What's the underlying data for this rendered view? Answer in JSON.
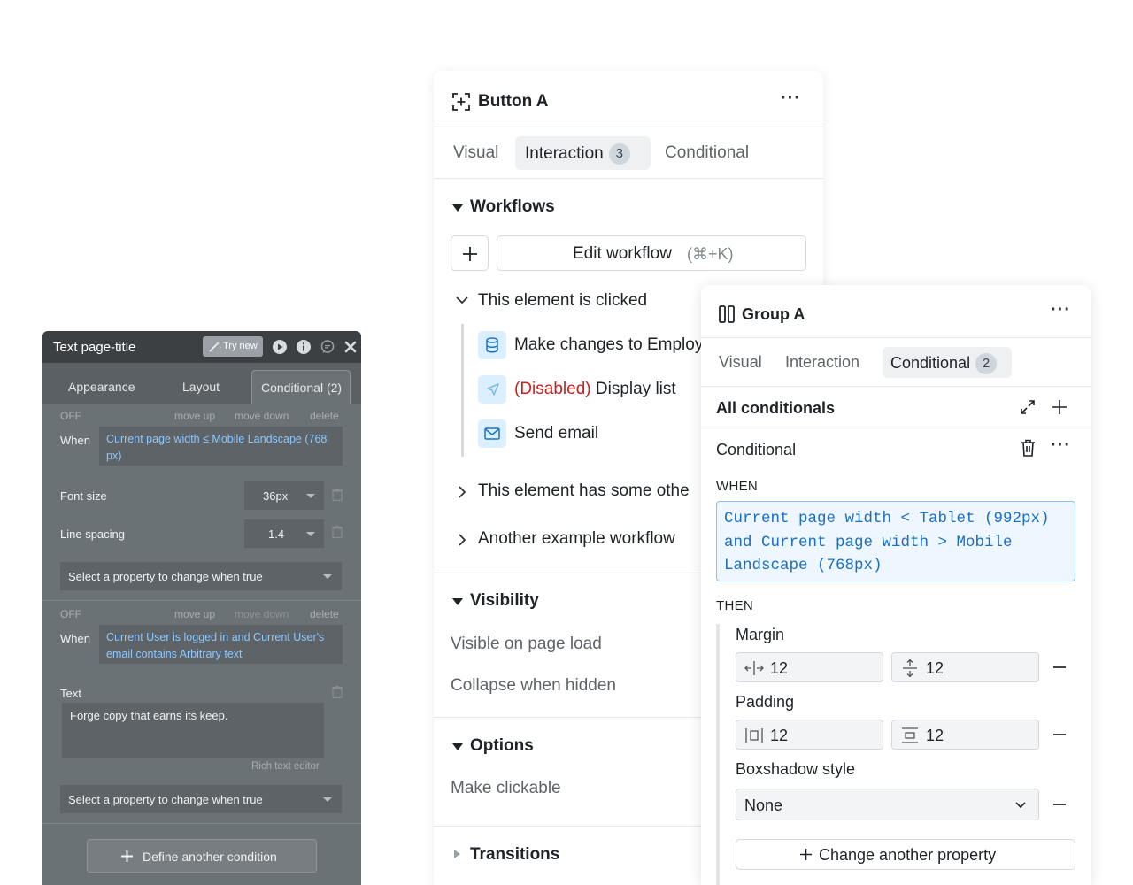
{
  "legacy_panel": {
    "title": "Text page-title",
    "try_new_label": "Try new",
    "tabs": [
      "Appearance",
      "Layout",
      "Conditional (2)"
    ],
    "conditions": [
      {
        "state": "OFF",
        "actions": [
          "move up",
          "move down",
          "delete"
        ],
        "when_label": "When",
        "expression": "Current page width ≤ Mobile Landscape (768 px)",
        "properties": [
          {
            "label": "Font size",
            "value": "36px"
          },
          {
            "label": "Line spacing",
            "value": "1.4"
          }
        ],
        "select_placeholder": "Select a property to change when true"
      },
      {
        "state": "OFF",
        "actions": [
          "move up",
          "move down",
          "delete"
        ],
        "when_label": "When",
        "expression": "Current User is logged in and Current User's email contains Arbitrary text",
        "text_label": "Text",
        "text_value": "Forge copy that earns its keep.",
        "rich_text_link": "Rich text editor",
        "select_placeholder": "Select a property to change when true"
      }
    ],
    "define_label": "Define another condition"
  },
  "button_panel": {
    "title": "Button A",
    "more_icon": "more-horizontal-icon",
    "tabs": [
      {
        "label": "Visual",
        "active": false
      },
      {
        "label": "Interaction",
        "active": true,
        "badge": "3"
      },
      {
        "label": "Conditional",
        "active": false
      }
    ],
    "workflows": {
      "heading": "Workflows",
      "edit_label": "Edit workflow",
      "edit_shortcut": "(⌘+K)",
      "items": [
        {
          "label": "This element is clicked",
          "expanded": true,
          "steps": [
            {
              "icon": "database-icon",
              "prefix": "",
              "label": "Make changes to Employ"
            },
            {
              "icon": "cursor-icon",
              "prefix": "(Disabled)",
              "label": " Display list"
            },
            {
              "icon": "mail-icon",
              "prefix": "",
              "label": "Send email"
            }
          ]
        },
        {
          "label": "This element has some othe",
          "expanded": false
        },
        {
          "label": "Another example workflow",
          "expanded": false
        }
      ]
    },
    "visibility": {
      "heading": "Visibility",
      "items": [
        "Visible on page load",
        "Collapse when hidden"
      ]
    },
    "options": {
      "heading": "Options",
      "items": [
        "Make clickable"
      ]
    },
    "transitions": {
      "heading": "Transitions"
    }
  },
  "group_panel": {
    "title": "Group A",
    "tabs": [
      {
        "label": "Visual",
        "active": false
      },
      {
        "label": "Interaction",
        "active": false
      },
      {
        "label": "Conditional",
        "active": true,
        "badge": "2"
      }
    ],
    "all_conditionals": "All conditionals",
    "conditional": {
      "heading": "Conditional",
      "when_label": "WHEN",
      "expression": "Current page width < Tablet (992px) and Current page width > Mobile Landscape (768px)",
      "then_label": "THEN",
      "properties": [
        {
          "label": "Margin",
          "values": [
            "12",
            "12"
          ]
        },
        {
          "label": "Padding",
          "values": [
            "12",
            "12"
          ]
        },
        {
          "label": "Boxshadow style",
          "value": "None"
        }
      ],
      "change_label": "Change another property"
    }
  }
}
